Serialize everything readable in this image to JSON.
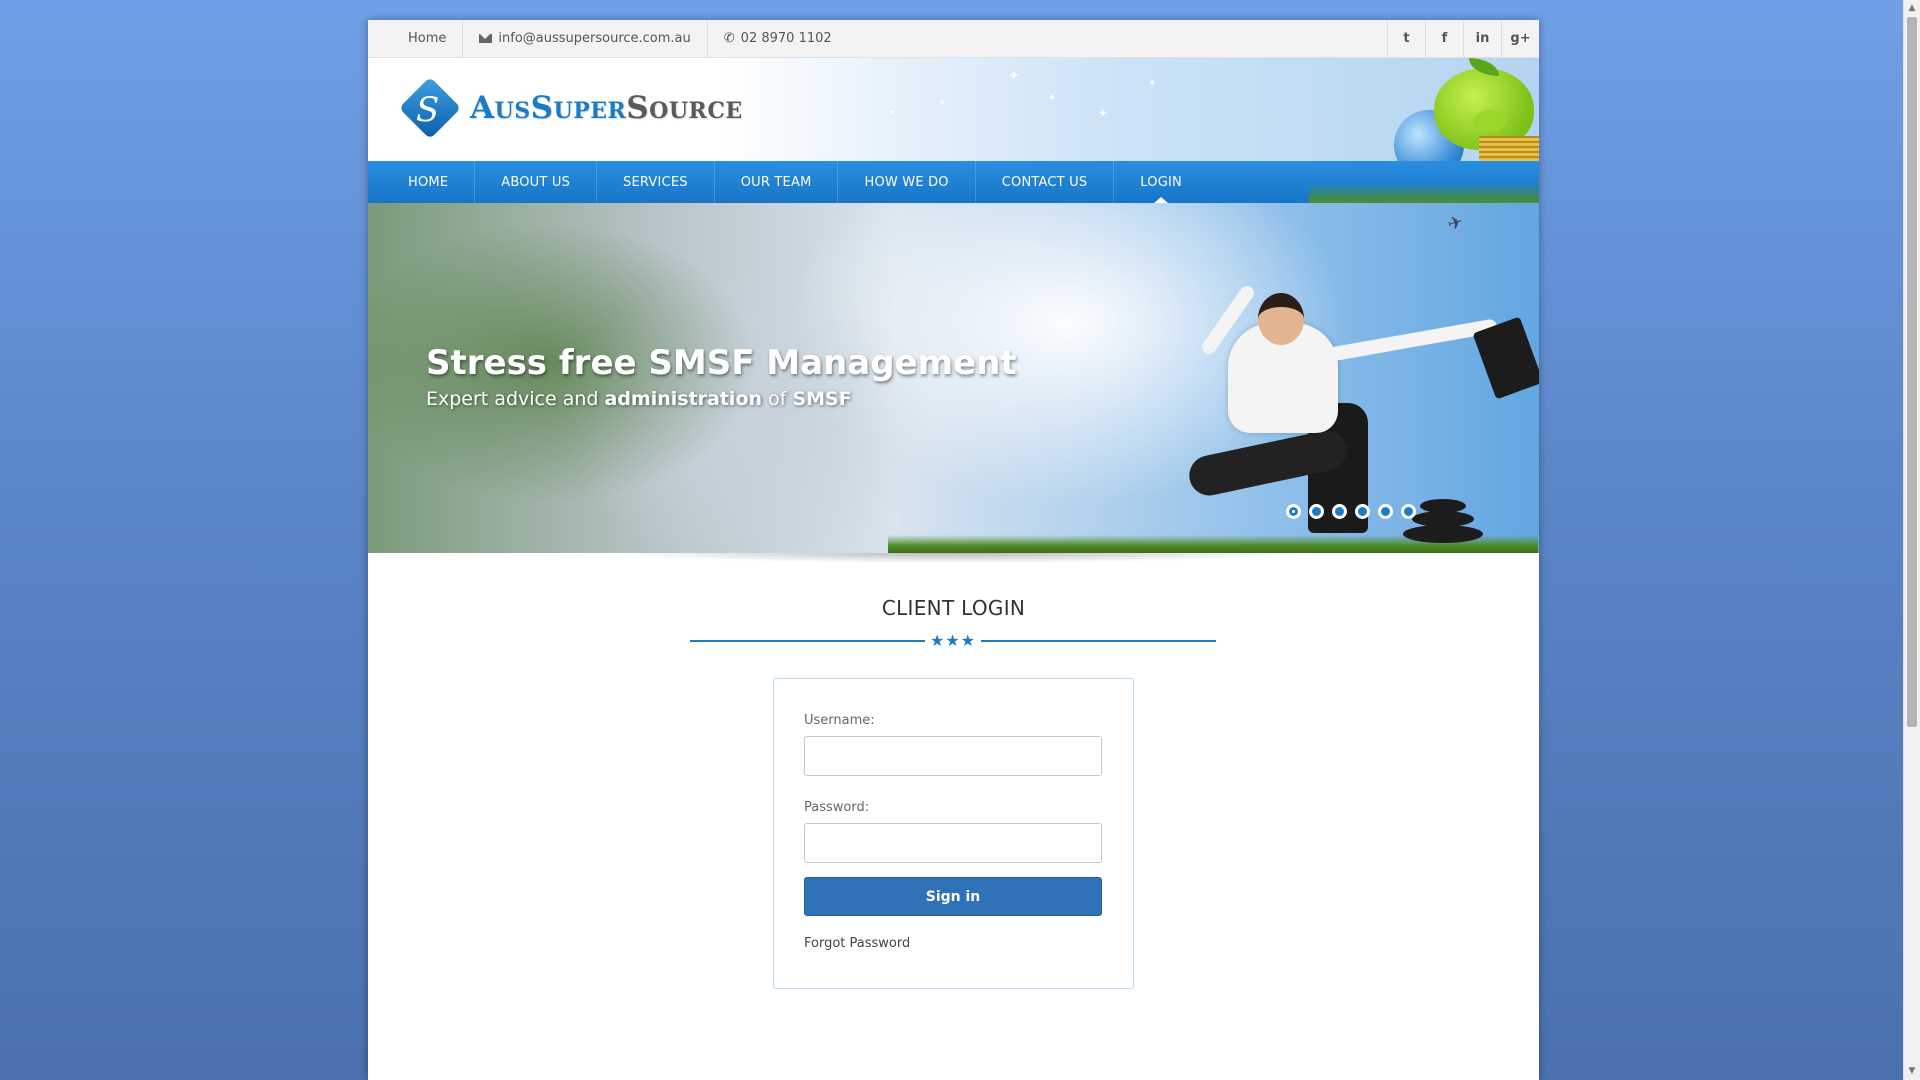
{
  "topbar": {
    "home_label": "Home",
    "email": "info@aussupersource.com.au",
    "phone": "02 8970 1102",
    "social": [
      {
        "name": "twitter-icon",
        "glyph": "t"
      },
      {
        "name": "facebook-icon",
        "glyph": "f"
      },
      {
        "name": "linkedin-icon",
        "glyph": "in"
      },
      {
        "name": "google-plus-icon",
        "glyph": "g+"
      }
    ]
  },
  "logo": {
    "part1": "AusSuper",
    "part2": "Source"
  },
  "nav": {
    "items": [
      {
        "label": "HOME"
      },
      {
        "label": "ABOUT US"
      },
      {
        "label": "SERVICES"
      },
      {
        "label": "OUR TEAM"
      },
      {
        "label": "HOW WE DO"
      },
      {
        "label": "CONTACT US"
      },
      {
        "label": "LOGIN",
        "active": true
      }
    ]
  },
  "slider": {
    "title": "Stress free SMSF Management",
    "sub_part1": "Expert advice and ",
    "sub_bold1": "administration",
    "sub_part2": " of ",
    "sub_bold2": "SMSF",
    "dot_count": 6,
    "active_dot": 1
  },
  "login": {
    "section_title": "CLIENT LOGIN",
    "username_label": "Username:",
    "username_value": "",
    "password_label": "Password:",
    "password_value": "",
    "signin_label": "Sign in",
    "forgot_label": "Forgot Password"
  },
  "colors": {
    "accent": "#1a7cc9",
    "nav_bg": "#1775c7",
    "button": "#2f72b8"
  }
}
